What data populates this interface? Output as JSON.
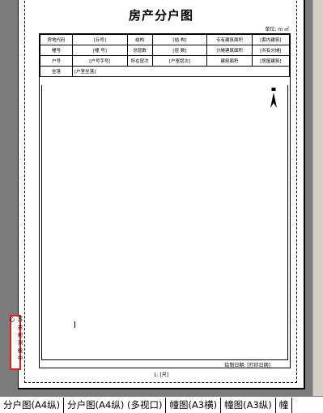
{
  "drawing": {
    "title": "房产分户图",
    "unit": "单位: m ㎡",
    "rows": [
      [
        "房地代码",
        "[丘号]",
        "结构",
        "[结 构]",
        "专有建筑面积",
        "[套内建筑]"
      ],
      [
        "幢号",
        "[幢 号]",
        "总层数",
        "[层 数]",
        "分摊建筑面积",
        "[共有分摊]"
      ],
      [
        "户号",
        "[户号字号]",
        "所在层次",
        "[户室层次]",
        "建筑面积",
        "[房屋建筑]"
      ]
    ],
    "address_label": "坐落",
    "address_value": "[户室坐落]",
    "draw_date": "绘制日期: [打印日期]",
    "scale": "1: [尺]",
    "seal": "苏 农 村 测 绘 中 心"
  },
  "tabs": [
    "分户图(A4纵)",
    "分户图(A4纵) (多视口)",
    "幢图(A3横)",
    "幢图(A3纵)",
    "幢"
  ],
  "active_tab": 0
}
